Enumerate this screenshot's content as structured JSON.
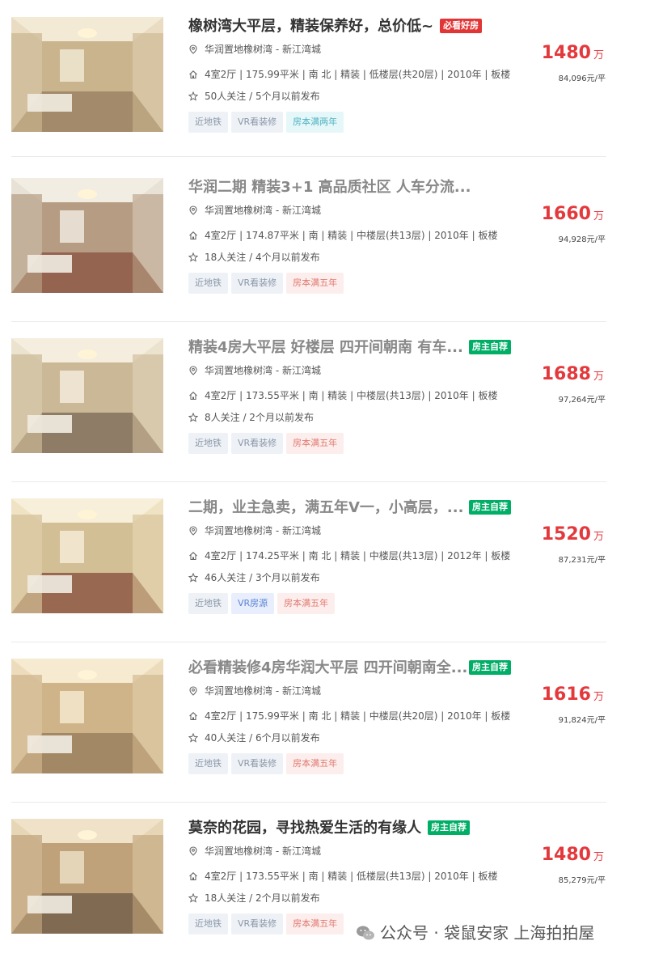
{
  "listings": [
    {
      "title": "橡树湾大平层，精装保养好，总价低~",
      "title_gray": false,
      "badge": "必看好房",
      "badge_color": "red",
      "location": "华润置地橡树湾 - 新江湾城",
      "specs": "4室2厅 | 175.99平米 | 南 北 | 精装 | 低楼层(共20层) | 2010年 | 板楼",
      "followers": "50人关注 / 5个月以前发布",
      "tags": [
        "近地铁",
        "VR看装修",
        "房本满两年"
      ],
      "price": "1480",
      "price_unit": "万",
      "unit_price": "84,096元/平"
    },
    {
      "title": "华润二期 精装3+1 高品质社区 人车分流...",
      "title_gray": true,
      "badge": "",
      "badge_color": "",
      "location": "华润置地橡树湾 - 新江湾城",
      "specs": "4室2厅 | 174.87平米 | 南 | 精装 | 中楼层(共13层) | 2010年 | 板楼",
      "followers": "18人关注 / 4个月以前发布",
      "tags": [
        "近地铁",
        "VR看装修",
        "房本满五年"
      ],
      "price": "1660",
      "price_unit": "万",
      "unit_price": "94,928元/平"
    },
    {
      "title": "精装4房大平层 好楼层 四开间朝南 有车...",
      "title_gray": true,
      "badge": "房主自荐",
      "badge_color": "green",
      "location": "华润置地橡树湾 - 新江湾城",
      "specs": "4室2厅 | 173.55平米 | 南 | 精装 | 中楼层(共13层) | 2010年 | 板楼",
      "followers": "8人关注 / 2个月以前发布",
      "tags": [
        "近地铁",
        "VR看装修",
        "房本满五年"
      ],
      "price": "1688",
      "price_unit": "万",
      "unit_price": "97,264元/平"
    },
    {
      "title": "二期，业主急卖，满五年V一，小高层，...",
      "title_gray": true,
      "badge": "房主自荐",
      "badge_color": "green",
      "location": "华润置地橡树湾 - 新江湾城",
      "specs": "4室2厅 | 174.25平米 | 南 北 | 精装 | 中楼层(共13层) | 2012年 | 板楼",
      "followers": "46人关注 / 3个月以前发布",
      "tags": [
        "近地铁",
        "VR房源",
        "房本满五年"
      ],
      "price": "1520",
      "price_unit": "万",
      "unit_price": "87,231元/平"
    },
    {
      "title": "必看精装修4房华润大平层 四开间朝南全...",
      "title_gray": true,
      "badge": "房主自荐",
      "badge_color": "green",
      "location": "华润置地橡树湾 - 新江湾城",
      "specs": "4室2厅 | 175.99平米 | 南 北 | 精装 | 中楼层(共20层) | 2010年 | 板楼",
      "followers": "40人关注 / 6个月以前发布",
      "tags": [
        "近地铁",
        "VR看装修",
        "房本满五年"
      ],
      "price": "1616",
      "price_unit": "万",
      "unit_price": "91,824元/平"
    },
    {
      "title": "莫奈的花园，寻找热爱生活的有缘人",
      "title_gray": false,
      "badge": "房主自荐",
      "badge_color": "green",
      "location": "华润置地橡树湾 - 新江湾城",
      "specs": "4室2厅 | 173.55平米 | 南 | 精装 | 低楼层(共13层) | 2010年 | 板楼",
      "followers": "18人关注 / 2个月以前发布",
      "tags": [
        "近地铁",
        "VR看装修",
        "房本满五年"
      ],
      "price": "1480",
      "price_unit": "万",
      "unit_price": "85,279元/平"
    }
  ],
  "watermark": "公众号 · 袋鼠安家 上海拍拍屋",
  "colors": {
    "price": "#e4393c",
    "badge_red": "#e03636",
    "badge_green": "#00ae66"
  }
}
